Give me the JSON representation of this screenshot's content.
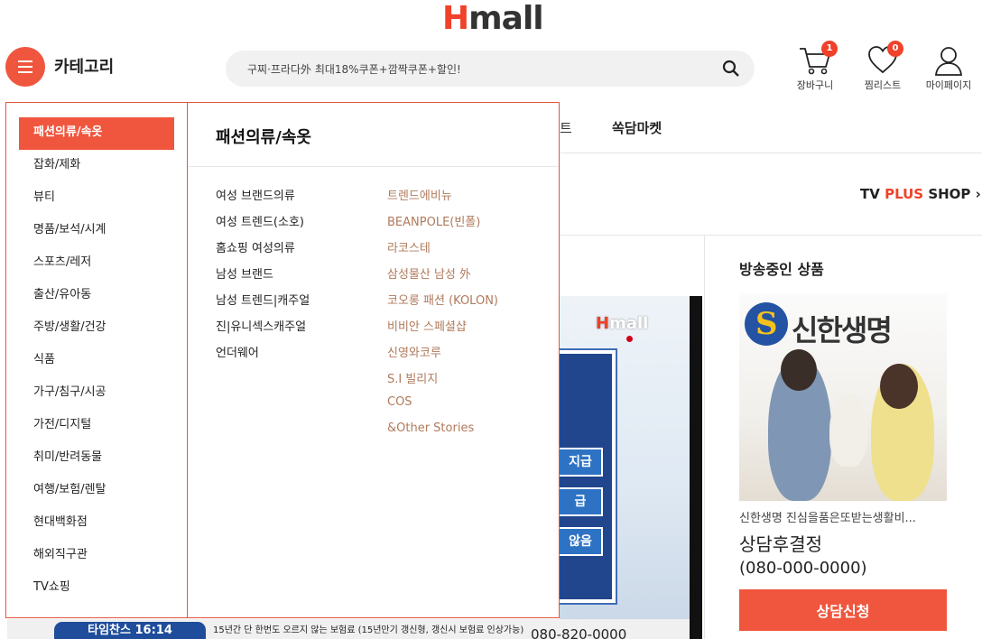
{
  "header": {
    "logo_h": "H",
    "logo_rest": "mall",
    "category_label": "카테고리",
    "search_placeholder": "구찌·프라다外 최대18%쿠폰+깜짝쿠폰+할인!",
    "cart_label": "장바구니",
    "cart_count": "1",
    "wish_label": "찜리스트",
    "wish_count": "0",
    "mypage_label": "마이페이지"
  },
  "icons": {
    "category": "hamburger-menu-icon",
    "search": "search-icon",
    "cart": "cart-icon",
    "wishlist": "heart-icon",
    "mypage": "user-icon"
  },
  "nav": {
    "partial_label": "트",
    "item_label": "쏙담마켓"
  },
  "tvplus": {
    "tv": "TV",
    "plus": "PLUS",
    "shop": "SHOP",
    "arrow": "›"
  },
  "video": {
    "logo_h": "H",
    "logo_rest": "mall",
    "pill1": "지급",
    "pill2": "급",
    "pill3": "않음",
    "ticker_badge": "타임찬스 16:14",
    "ticker_text": "15년간 단 한번도 오르지 않는 보험료 (15년만기 갱신형, 갱신시 보험료 인상가능)",
    "ticker_phone": "080-820-0000"
  },
  "broadcast": {
    "title": "방송중인 상품",
    "brand": "신한생명",
    "description": "신한생명 진심을품은또받는생활비...",
    "price": "상담후결정",
    "phone": "(080-000-0000)",
    "button": "상담신청"
  },
  "categories": [
    "패션의류/속옷",
    "잡화/제화",
    "뷰티",
    "명품/보석/시계",
    "스포츠/레저",
    "출산/유아동",
    "주방/생활/건강",
    "식품",
    "가구/침구/시공",
    "가전/디지털",
    "취미/반려동물",
    "여행/보험/렌탈",
    "현대백화점",
    "해외직구관",
    "TV쇼핑"
  ],
  "active_category": "패션의류/속옷",
  "sub_title": "패션의류/속옷",
  "sub_categories": [
    "여성 브랜드의류",
    "여성 트렌드(소호)",
    "홈쇼핑 여성의류",
    "남성 브랜드",
    "남성 트렌드|캐주얼",
    "진|유니섹스캐주얼",
    "언더웨어"
  ],
  "brands": [
    "트렌드에비뉴",
    "BEANPOLE(빈폴)",
    "라코스테",
    "삼성물산 남성 外",
    "코오롱 패션 (KOLON)",
    "비비안 스페셜샵",
    "신영와코루",
    "S.I 빌리지",
    "COS",
    "&Other Stories"
  ],
  "colors": {
    "brand_red": "#f0412a",
    "active_bg": "#f0563e",
    "brand_link": "#b07a5c"
  }
}
